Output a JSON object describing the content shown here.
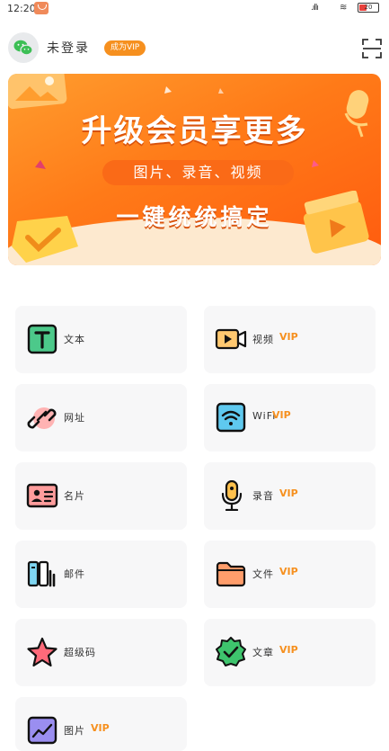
{
  "status_bar": {
    "time": "12:20",
    "battery": "20"
  },
  "header": {
    "login_text": "未登录",
    "vip_button": "成为VIP"
  },
  "banner": {
    "title": "升级会员享更多",
    "pill": "图片、录音、视频",
    "subtitle": "一键统统搞定"
  },
  "grid": {
    "text": {
      "label": "文本",
      "vip": ""
    },
    "video": {
      "label": "视频",
      "vip": "VIP"
    },
    "url": {
      "label": "网址",
      "vip": ""
    },
    "wifi": {
      "label": "WiFi",
      "vip": "VIP"
    },
    "card": {
      "label": "名片",
      "vip": ""
    },
    "audio": {
      "label": "录音",
      "vip": "VIP"
    },
    "mail": {
      "label": "邮件",
      "vip": ""
    },
    "file": {
      "label": "文件",
      "vip": "VIP"
    },
    "super": {
      "label": "超级码",
      "vip": ""
    },
    "article": {
      "label": "文章",
      "vip": "VIP"
    },
    "image": {
      "label": "图片",
      "vip": "VIP"
    }
  },
  "colors": {
    "accent": "#f6901f",
    "banner": "#ff7a18",
    "card_bg": "#f7f7f8"
  }
}
